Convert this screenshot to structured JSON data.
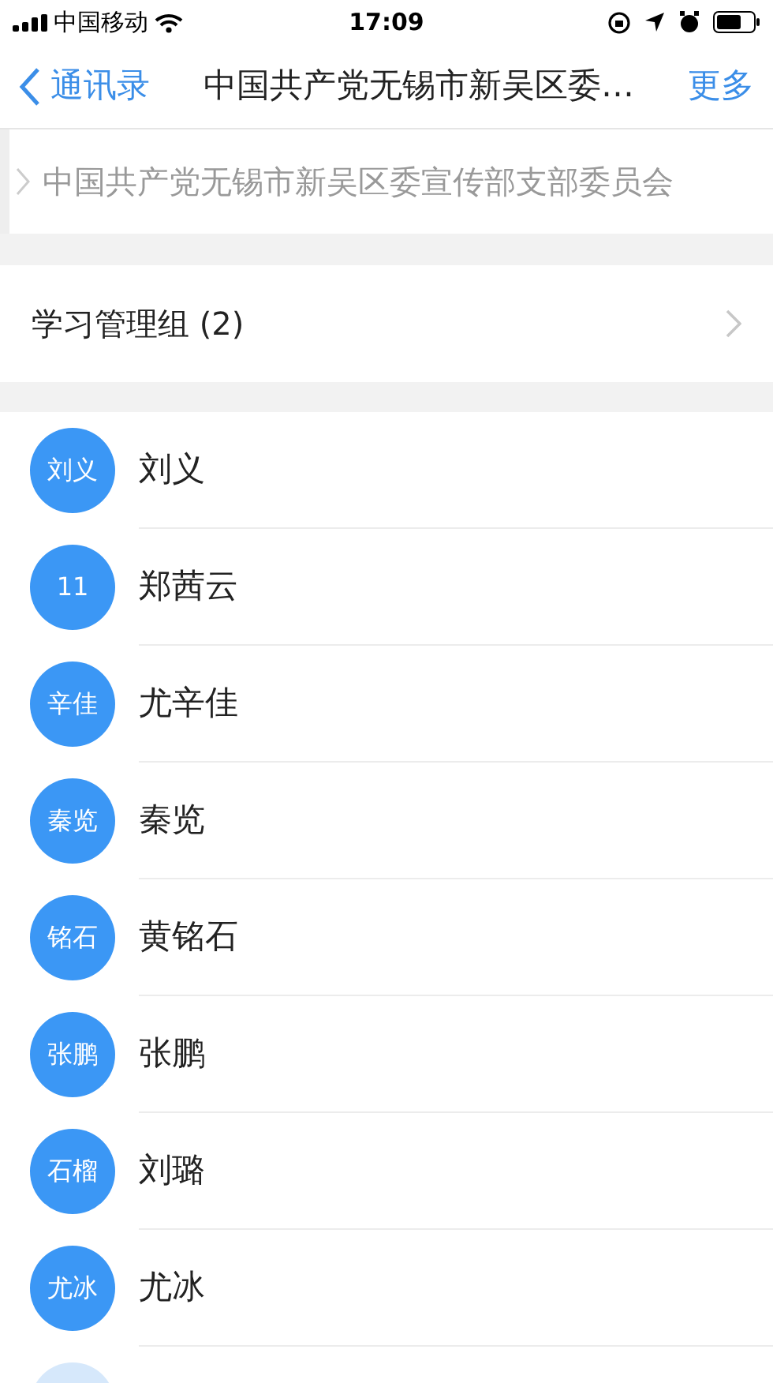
{
  "status_bar": {
    "carrier": "中国移动",
    "time": "17:09"
  },
  "nav": {
    "back": "通讯录",
    "title": "中国共产党无锡市新吴区委…",
    "more": "更多"
  },
  "breadcrumb": "中国共产党无锡市新吴区委宣传部支部委员会",
  "group": {
    "label": "学习管理组 (2)"
  },
  "contacts": [
    {
      "avatar": "刘义",
      "name": "刘义"
    },
    {
      "avatar": "11",
      "name": "郑茜云"
    },
    {
      "avatar": "辛佳",
      "name": "尤辛佳"
    },
    {
      "avatar": "秦览",
      "name": "秦览"
    },
    {
      "avatar": "铭石",
      "name": "黄铭石"
    },
    {
      "avatar": "张鹏",
      "name": "张鹏"
    },
    {
      "avatar": "石榴",
      "name": "刘璐"
    },
    {
      "avatar": "尤冰",
      "name": "尤冰"
    }
  ]
}
